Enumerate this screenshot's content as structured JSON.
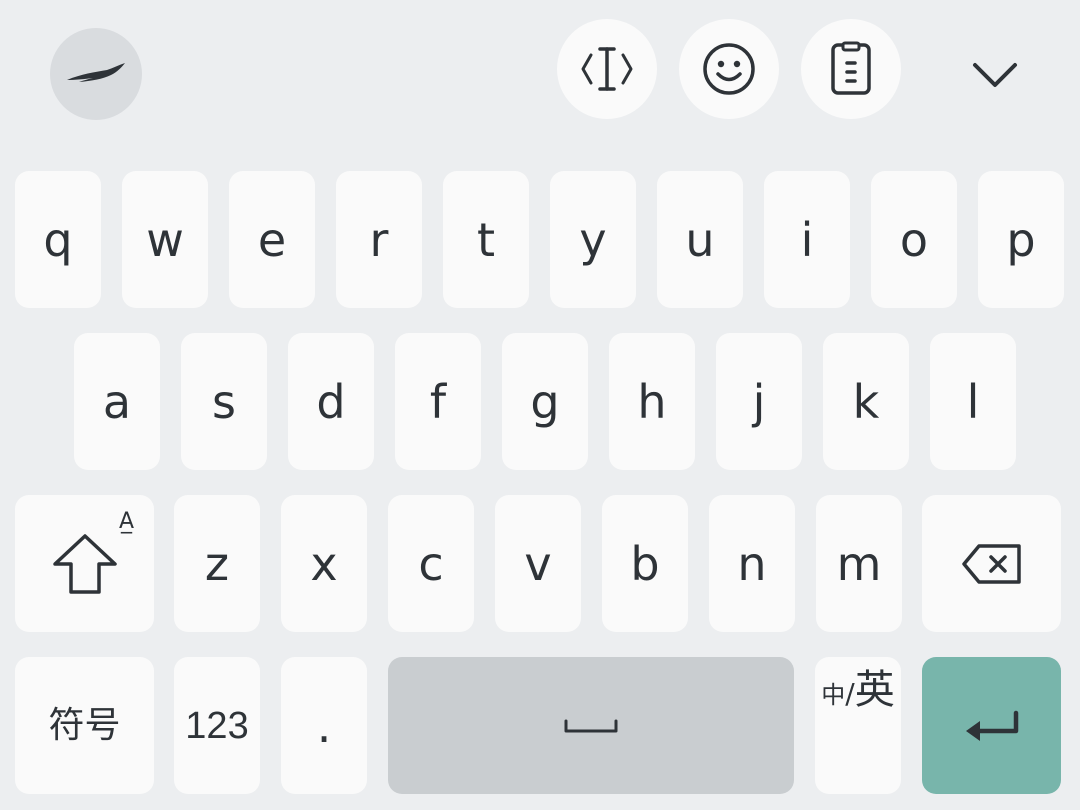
{
  "toolbar": {
    "logo_icon": "swallow-logo-icon",
    "tools": [
      {
        "icon": "text-cursor-icon"
      },
      {
        "icon": "smiley-icon"
      },
      {
        "icon": "clipboard-icon"
      }
    ],
    "collapse_icon": "chevron-down-icon"
  },
  "keyboard": {
    "row1": [
      "q",
      "w",
      "e",
      "r",
      "t",
      "y",
      "u",
      "i",
      "o",
      "p"
    ],
    "row2": [
      "a",
      "s",
      "d",
      "f",
      "g",
      "h",
      "j",
      "k",
      "l"
    ],
    "row3": [
      "z",
      "x",
      "c",
      "v",
      "b",
      "n",
      "m"
    ],
    "shift_hint": "A̲",
    "symbols_label": "符号",
    "numbers_label": "123",
    "period_label": ".",
    "space_icon": "space-bar-icon",
    "lang_small": "中",
    "lang_slash": "/",
    "lang_big": "英",
    "enter_icon": "enter-arrow-icon",
    "backspace_icon": "backspace-icon",
    "shift_icon": "shift-arrow-icon",
    "colors": {
      "background": "#eceef0",
      "key": "#fafafa",
      "space": "#c9cdd0",
      "enter": "#78b5ab",
      "text": "#2e3338"
    }
  }
}
